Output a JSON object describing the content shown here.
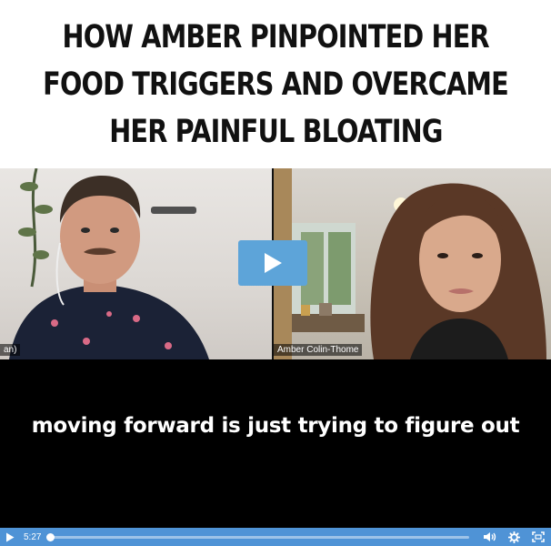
{
  "headline": {
    "lines": [
      "HOW AMBER PINPOINTED HER",
      "FOOD TRIGGERS AND OVERCAME",
      "HER PAINFUL BLOATING"
    ]
  },
  "video": {
    "participants": [
      {
        "name": "an)"
      },
      {
        "name": "Amber Colin-Thome"
      }
    ],
    "caption": "moving forward is just trying to figure out"
  },
  "player": {
    "current_time": "5:27",
    "progress": 0.0,
    "icons": {
      "play": "play-icon",
      "volume": "volume-icon",
      "settings": "gear-icon",
      "fullscreen": "fullscreen-icon"
    },
    "colors": {
      "control_bar": "#4f93d6",
      "play_overlay": "#5da4d9"
    }
  }
}
